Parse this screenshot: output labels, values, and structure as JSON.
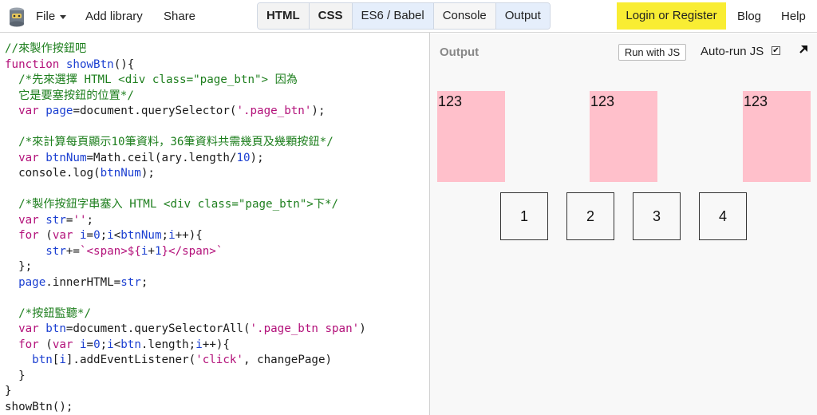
{
  "menu": {
    "file": "File",
    "add_library": "Add library",
    "share": "Share"
  },
  "tabs": [
    "HTML",
    "CSS",
    "ES6 / Babel",
    "Console",
    "Output"
  ],
  "account": {
    "login": "Login or Register",
    "blog": "Blog",
    "help": "Help"
  },
  "colors": {
    "accent": "#f9ed33",
    "pink_box": "#ffc0cb",
    "tab_active": "#e5eefb"
  },
  "code_lines": [
    "//來製作按鈕吧",
    "function showBtn(){",
    "  /*先來選擇 HTML <div class=\"page_btn\"> 因為",
    "  它是要塞按鈕的位置*/",
    "  var page=document.querySelector('.page_btn');",
    "",
    "  /*來計算每頁顯示10筆資料，36筆資料共需幾頁及幾顆按鈕*/",
    "  var btnNum=Math.ceil(ary.length/10);",
    "  console.log(btnNum);",
    "",
    "  /*製作按鈕字串塞入 HTML <div class=\"page_btn\">下*/",
    "  var str='';",
    "  for (var i=0;i<btnNum;i++){",
    "      str+=`<span>${i+1}</span>`",
    "  };",
    "  page.innerHTML=str;",
    "",
    "  /*按鈕監聽*/",
    "  var btn=document.querySelectorAll('.page_btn span')",
    "  for (var i=0;i<btn.length;i++){",
    "    btn[i].addEventListener('click', changePage)",
    "  }",
    "}",
    "showBtn();"
  ],
  "output": {
    "title": "Output",
    "run_button": "Run with JS",
    "autorun_label": "Auto-run JS",
    "autorun_checked": "✔",
    "boxes": [
      "123",
      "123",
      "123"
    ],
    "page_buttons": [
      "1",
      "2",
      "3",
      "4"
    ]
  }
}
